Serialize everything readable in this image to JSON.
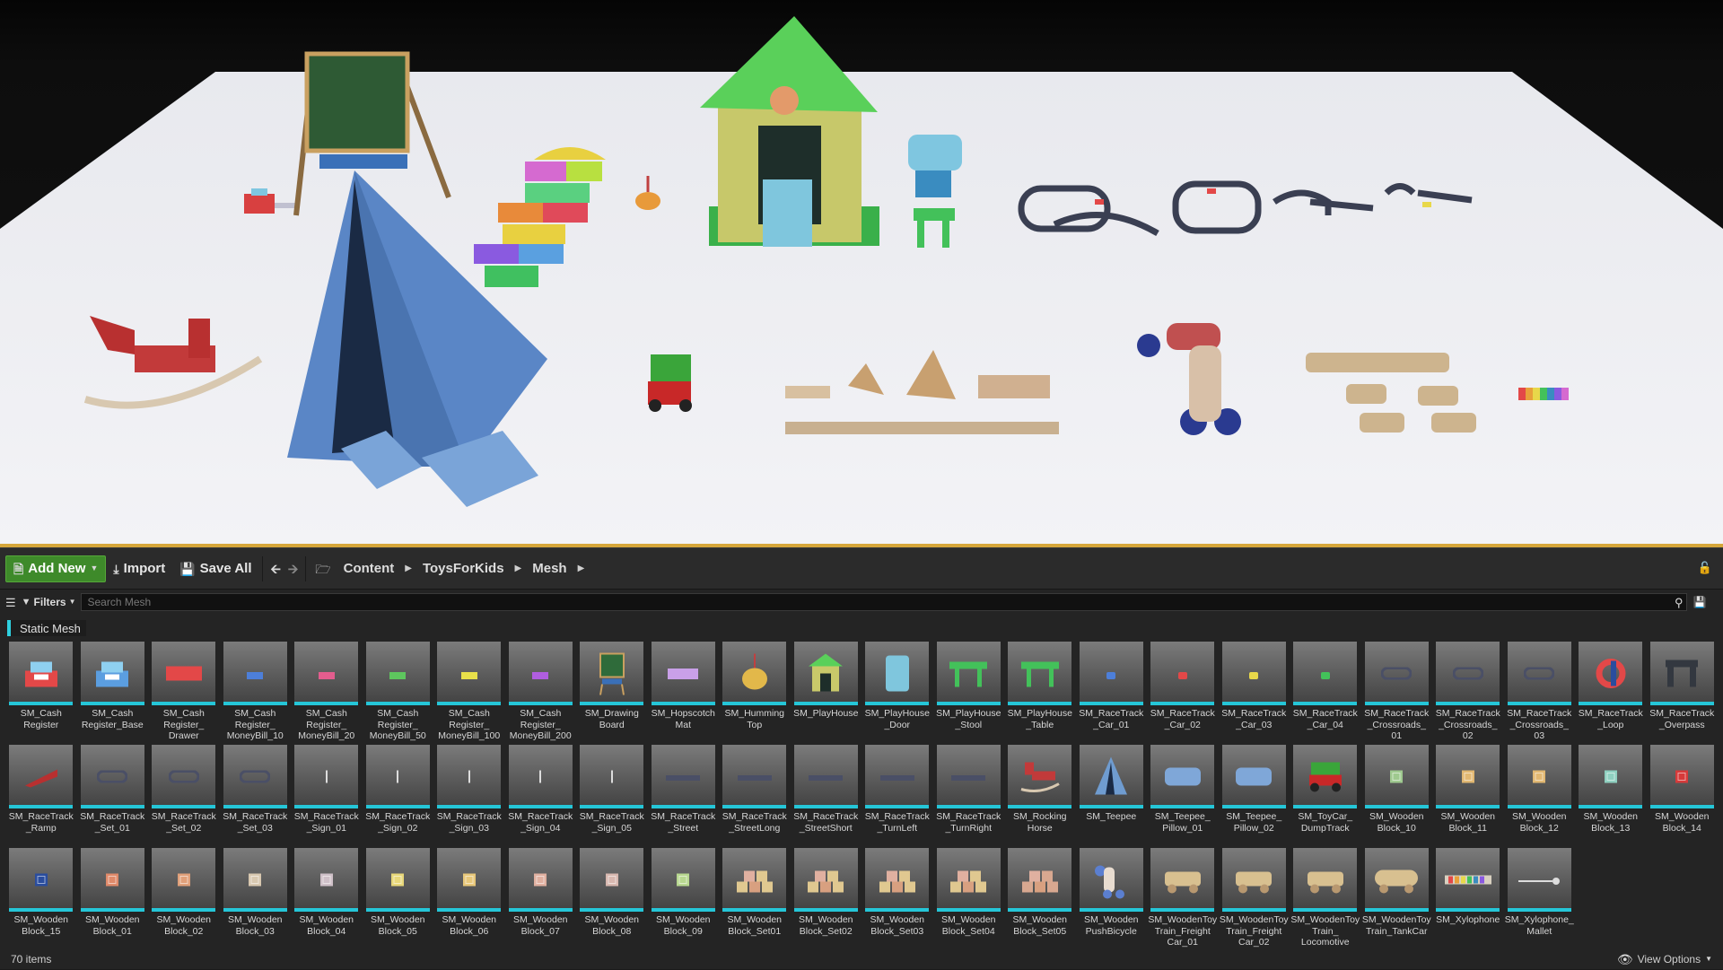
{
  "toolbar": {
    "add_new_label": "Add New",
    "import_label": "Import",
    "save_all_label": "Save All",
    "breadcrumb": [
      "Content",
      "ToysForKids",
      "Mesh"
    ]
  },
  "filters": {
    "filters_label": "Filters",
    "search_placeholder": "Search Mesh",
    "active_filter": "Static Mesh"
  },
  "status": {
    "item_count": "70 items",
    "view_options_label": "View Options"
  },
  "colors": {
    "accent_cyan": "#25c6d8",
    "add_new_green": "#3e8a2a",
    "viewport_border": "#d6a63a"
  },
  "assets": [
    {
      "name": "SM_Cash Register",
      "icon": "register",
      "color": "#e34848"
    },
    {
      "name": "SM_Cash Register_Base",
      "icon": "register",
      "color": "#5b9ee0"
    },
    {
      "name": "SM_Cash Register_ Drawer",
      "icon": "box",
      "color": "#e34848"
    },
    {
      "name": "SM_Cash Register_ MoneyBill_10",
      "icon": "bill",
      "color": "#4d7fd9"
    },
    {
      "name": "SM_Cash Register_ MoneyBill_20",
      "icon": "bill",
      "color": "#e35d8e"
    },
    {
      "name": "SM_Cash Register_ MoneyBill_50",
      "icon": "bill",
      "color": "#5ec65e"
    },
    {
      "name": "SM_Cash Register_ MoneyBill_100",
      "icon": "bill",
      "color": "#e8e04a"
    },
    {
      "name": "SM_Cash Register_ MoneyBill_200",
      "icon": "bill",
      "color": "#b05ee0"
    },
    {
      "name": "SM_Drawing Board",
      "icon": "board",
      "color": "#2f6b3a"
    },
    {
      "name": "SM_Hopscotch Mat",
      "icon": "mat",
      "color": "#c9a0e8"
    },
    {
      "name": "SM_Humming Top",
      "icon": "top",
      "color": "#e2b84a"
    },
    {
      "name": "SM_PlayHouse",
      "icon": "house",
      "color": "#c9c96a"
    },
    {
      "name": "SM_PlayHouse _Door",
      "icon": "door",
      "color": "#7fc6dd"
    },
    {
      "name": "SM_PlayHouse _Stool",
      "icon": "stool",
      "color": "#43c15a"
    },
    {
      "name": "SM_PlayHouse _Table",
      "icon": "stool",
      "color": "#43c15a"
    },
    {
      "name": "SM_RaceTrack _Car_01",
      "icon": "car",
      "color": "#4d7fd9"
    },
    {
      "name": "SM_RaceTrack _Car_02",
      "icon": "car",
      "color": "#e34848"
    },
    {
      "name": "SM_RaceTrack _Car_03",
      "icon": "car",
      "color": "#e8d84a"
    },
    {
      "name": "SM_RaceTrack _Car_04",
      "icon": "car",
      "color": "#43c15a"
    },
    {
      "name": "SM_RaceTrack _Crossroads_ 01",
      "icon": "track",
      "color": "#4a4f66"
    },
    {
      "name": "SM_RaceTrack _Crossroads_ 02",
      "icon": "track",
      "color": "#4a4f66"
    },
    {
      "name": "SM_RaceTrack _Crossroads_ 03",
      "icon": "track",
      "color": "#4a4f66"
    },
    {
      "name": "SM_RaceTrack _Loop",
      "icon": "loop",
      "color": "#e34848"
    },
    {
      "name": "SM_RaceTrack _Overpass",
      "icon": "overpass",
      "color": "#333840"
    },
    {
      "name": "SM_RaceTrack _Ramp",
      "icon": "ramp",
      "color": "#b83030"
    },
    {
      "name": "SM_RaceTrack _Set_01",
      "icon": "track",
      "color": "#4a4f66"
    },
    {
      "name": "SM_RaceTrack _Set_02",
      "icon": "track",
      "color": "#4a4f66"
    },
    {
      "name": "SM_RaceTrack _Set_03",
      "icon": "track",
      "color": "#4a4f66"
    },
    {
      "name": "SM_RaceTrack _Sign_01",
      "icon": "sign",
      "color": "#dddddd"
    },
    {
      "name": "SM_RaceTrack _Sign_02",
      "icon": "sign",
      "color": "#dddddd"
    },
    {
      "name": "SM_RaceTrack _Sign_03",
      "icon": "sign",
      "color": "#dddddd"
    },
    {
      "name": "SM_RaceTrack _Sign_04",
      "icon": "sign",
      "color": "#dddddd"
    },
    {
      "name": "SM_RaceTrack _Sign_05",
      "icon": "sign",
      "color": "#dddddd"
    },
    {
      "name": "SM_RaceTrack _Street",
      "icon": "street",
      "color": "#4a4f66"
    },
    {
      "name": "SM_RaceTrack _StreetLong",
      "icon": "street",
      "color": "#4a4f66"
    },
    {
      "name": "SM_RaceTrack _StreetShort",
      "icon": "street",
      "color": "#4a4f66"
    },
    {
      "name": "SM_RaceTrack _TurnLeft",
      "icon": "street",
      "color": "#4a4f66"
    },
    {
      "name": "SM_RaceTrack _TurnRight",
      "icon": "street",
      "color": "#4a4f66"
    },
    {
      "name": "SM_Rocking Horse",
      "icon": "horse",
      "color": "#c23a3a"
    },
    {
      "name": "SM_Teepee",
      "icon": "teepee",
      "color": "#6f9cd0"
    },
    {
      "name": "SM_Teepee_ Pillow_01",
      "icon": "pillow",
      "color": "#7fa7d8"
    },
    {
      "name": "SM_Teepee_ Pillow_02",
      "icon": "pillow",
      "color": "#7fa7d8"
    },
    {
      "name": "SM_ToyCar_ DumpTrack",
      "icon": "truck",
      "color": "#3aa53a"
    },
    {
      "name": "SM_Wooden Block_10",
      "icon": "block",
      "color": "#9fc98f"
    },
    {
      "name": "SM_Wooden Block_11",
      "icon": "block",
      "color": "#e2b872"
    },
    {
      "name": "SM_Wooden Block_12",
      "icon": "block",
      "color": "#e2b872"
    },
    {
      "name": "SM_Wooden Block_13",
      "icon": "block",
      "color": "#8fd0c0"
    },
    {
      "name": "SM_Wooden Block_14",
      "icon": "block",
      "color": "#d63a3a"
    },
    {
      "name": "SM_Wooden Block_15",
      "icon": "block",
      "color": "#2a4d9e"
    },
    {
      "name": "SM_Wooden Block_01",
      "icon": "block",
      "color": "#e08a6a"
    },
    {
      "name": "SM_Wooden Block_02",
      "icon": "block",
      "color": "#e0a07a"
    },
    {
      "name": "SM_Wooden Block_03",
      "icon": "block",
      "color": "#d8c8b0"
    },
    {
      "name": "SM_Wooden Block_04",
      "icon": "block",
      "color": "#cfc0c8"
    },
    {
      "name": "SM_Wooden Block_05",
      "icon": "block",
      "color": "#e8d87a"
    },
    {
      "name": "SM_Wooden Block_06",
      "icon": "block",
      "color": "#e8c87a"
    },
    {
      "name": "SM_Wooden Block_07",
      "icon": "block",
      "color": "#e0b0a0"
    },
    {
      "name": "SM_Wooden Block_08",
      "icon": "block",
      "color": "#d8b8b0"
    },
    {
      "name": "SM_Wooden Block_09",
      "icon": "block",
      "color": "#b8d890"
    },
    {
      "name": "SM_Wooden Block_Set01",
      "icon": "blocks",
      "color": "#e0c890"
    },
    {
      "name": "SM_Wooden Block_Set02",
      "icon": "blocks",
      "color": "#e0c890"
    },
    {
      "name": "SM_Wooden Block_Set03",
      "icon": "blocks",
      "color": "#e0c890"
    },
    {
      "name": "SM_Wooden Block_Set04",
      "icon": "blocks",
      "color": "#e0c890"
    },
    {
      "name": "SM_Wooden Block_Set05",
      "icon": "blocks",
      "color": "#d8a890"
    },
    {
      "name": "SM_Wooden PushBicycle",
      "icon": "bicycle",
      "color": "#5b7fd0"
    },
    {
      "name": "SM_WoodenToy Train_Freight Car_01",
      "icon": "train",
      "color": "#d8c090"
    },
    {
      "name": "SM_WoodenToy Train_Freight Car_02",
      "icon": "train",
      "color": "#d8c090"
    },
    {
      "name": "SM_WoodenToy Train_ Locomotive",
      "icon": "train",
      "color": "#d8c090"
    },
    {
      "name": "SM_WoodenToy Train_TankCar",
      "icon": "tank",
      "color": "#d8c090"
    },
    {
      "name": "SM_Xylophone",
      "icon": "xylophone",
      "color": "#d8d0c0"
    },
    {
      "name": "SM_Xylophone_ Mallet",
      "icon": "mallet",
      "color": "#dddddd"
    }
  ]
}
